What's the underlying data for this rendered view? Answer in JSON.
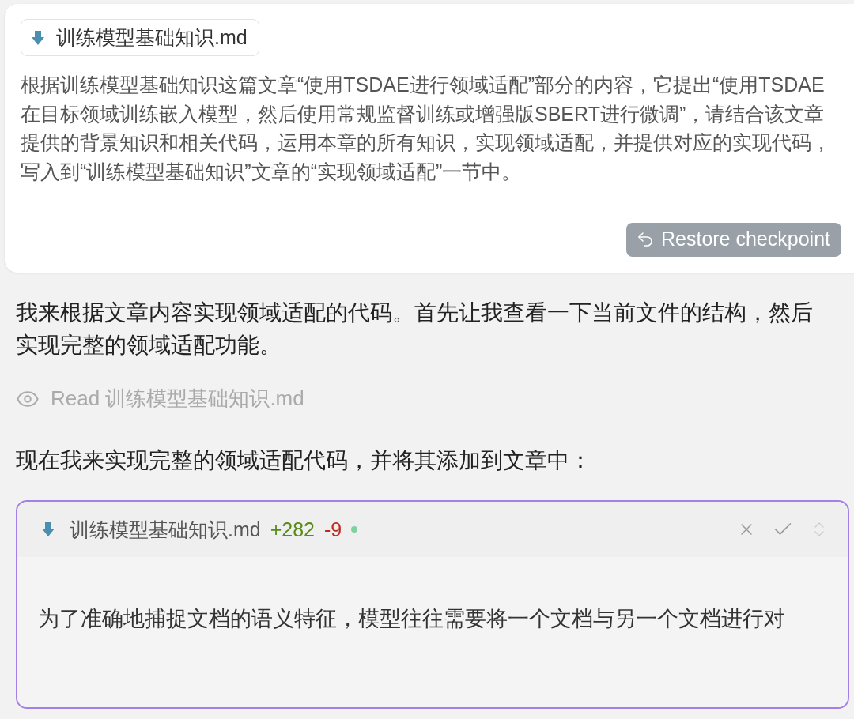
{
  "attachment": {
    "filename": "训练模型基础知识.md"
  },
  "prompt": "根据训练模型基础知识这篇文章“使用TSDAE进行领域适配”部分的内容，它提出“使用TSDAE在目标领域训练嵌入模型，然后使用常规监督训练或增强版SBERT进行微调”，请结合该文章提供的背景知识和相关代码，运用本章的所有知识，实现领域适配，并提供对应的实现代码，写入到“训练模型基础知识”文章的“实现领域适配”一节中。",
  "restore_button": {
    "label": "Restore checkpoint"
  },
  "response": [
    {
      "kind": "paragraph",
      "text": "我来根据文章内容实现领域适配的代码。首先让我查看一下当前文件的结构，然后实现完整的领域适配功能。"
    },
    {
      "kind": "read",
      "text": "Read 训练模型基础知识.md"
    },
    {
      "kind": "paragraph",
      "text": "现在我来实现完整的领域适配代码，并将其添加到文章中："
    },
    {
      "kind": "diff",
      "filename": "训练模型基础知识.md",
      "added": "+282",
      "removed": "-9",
      "content": "为了准确地捕捉文档的语义特征，模型往往需要将一个文档与另一个文档进行对"
    }
  ]
}
